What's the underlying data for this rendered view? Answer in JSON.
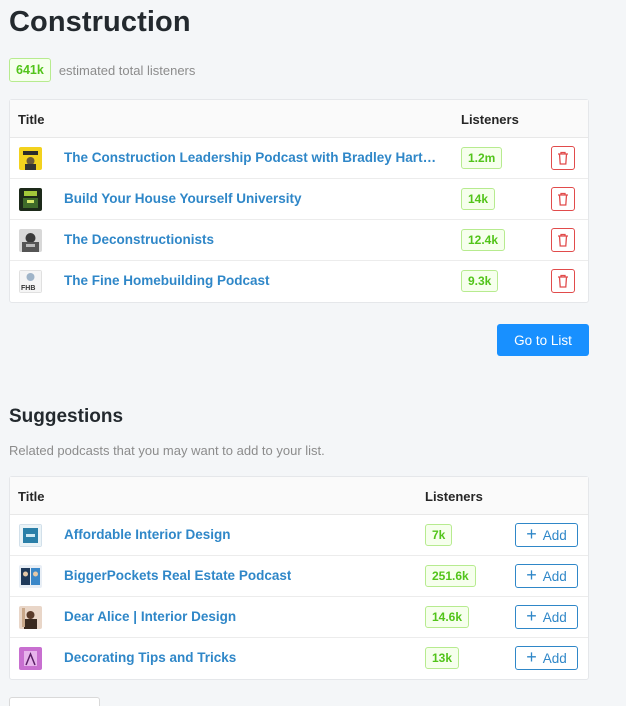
{
  "list": {
    "title": "Construction",
    "total_listeners": "641k",
    "total_label": "estimated total listeners",
    "columns": {
      "title": "Title",
      "listeners": "Listeners"
    },
    "rows": [
      {
        "title": "The Construction Leadership Podcast with Bradley Hartm...",
        "listeners": "1.2m",
        "thumb": "construction-leadership-cover"
      },
      {
        "title": "Build Your House Yourself University",
        "listeners": "14k",
        "thumb": "build-your-house-cover"
      },
      {
        "title": "The Deconstructionists",
        "listeners": "12.4k",
        "thumb": "deconstructionists-cover"
      },
      {
        "title": "The Fine Homebuilding Podcast",
        "listeners": "9.3k",
        "thumb": "fine-homebuilding-cover"
      }
    ],
    "goto_label": "Go to List"
  },
  "suggestions": {
    "title": "Suggestions",
    "subtitle": "Related podcasts that you may want to add to your list.",
    "columns": {
      "title": "Title",
      "listeners": "Listeners"
    },
    "add_label": "Add",
    "rows": [
      {
        "title": "Affordable Interior Design",
        "listeners": "7k",
        "thumb": "affordable-interior-cover"
      },
      {
        "title": "BiggerPockets Real Estate Podcast",
        "listeners": "251.6k",
        "thumb": "biggerpockets-cover"
      },
      {
        "title": "Dear Alice | Interior Design",
        "listeners": "14.6k",
        "thumb": "dear-alice-cover"
      },
      {
        "title": "Decorating Tips and Tricks",
        "listeners": "13k",
        "thumb": "decorating-tips-cover"
      }
    ]
  },
  "colors": {
    "link": "#2f87c8",
    "primary_button": "#1890ff",
    "tag_green": "#52c41a",
    "delete_red": "#e14b4b"
  }
}
